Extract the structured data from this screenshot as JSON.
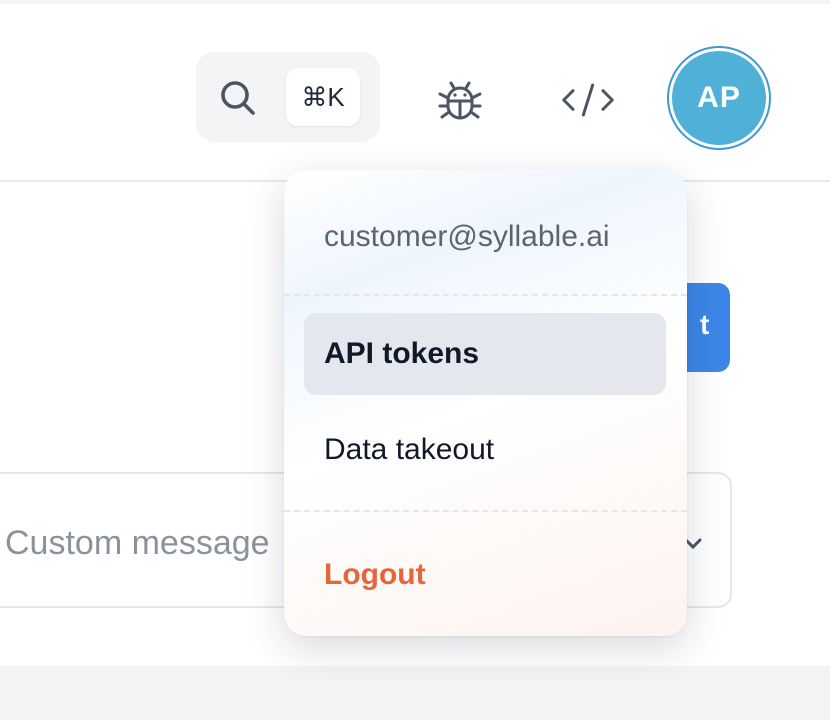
{
  "header": {
    "search": {
      "shortcut": "⌘K",
      "icon": "search-icon"
    },
    "bug_icon": "bug-icon",
    "code_icon": "code-icon",
    "avatar": {
      "initials": "AP",
      "color": "#4fb0d8",
      "ring_color": "#3b9bd1"
    }
  },
  "main": {
    "primary_button_label": "t",
    "primary_button_color": "#3b87e8",
    "message_field": {
      "placeholder": "Custom message"
    }
  },
  "user_menu": {
    "email": "customer@syllable.ai",
    "items": [
      {
        "label": "API tokens",
        "active": true
      },
      {
        "label": "Data takeout",
        "active": false
      }
    ],
    "logout_label": "Logout",
    "logout_color": "#e8653a"
  }
}
